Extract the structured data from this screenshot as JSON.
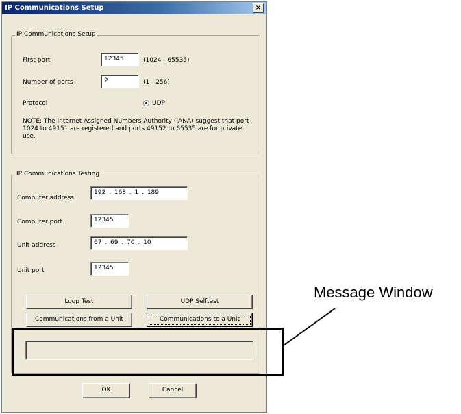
{
  "dialog": {
    "title": "IP Communications Setup",
    "close_glyph": "×"
  },
  "setup": {
    "group_title": "IP Communications Setup",
    "first_port": {
      "label": "First port",
      "value": "12345",
      "range": "(1024 - 65535)"
    },
    "num_ports": {
      "label": "Number of ports",
      "value": "2",
      "range": "(1 - 256)"
    },
    "protocol": {
      "label": "Protocol",
      "option": "UDP",
      "selected": true
    },
    "note": "NOTE: The Internet Assigned Numbers Authority (IANA) suggest that port 1024 to 49151 are registered and ports 49152  to 65535 are for private use."
  },
  "testing": {
    "group_title": "IP Communications Testing",
    "computer_address": {
      "label": "Computer address",
      "value": "192  .  168  .  1    .  189"
    },
    "computer_port": {
      "label": "Computer port",
      "value": "12345"
    },
    "unit_address": {
      "label": "Unit address",
      "value": "67   .  69   .  70   .  10"
    },
    "unit_port": {
      "label": "Unit port",
      "value": "12345"
    },
    "buttons": {
      "loop_test": "Loop Test",
      "udp_selftest": "UDP Selftest",
      "comm_from_unit": "Communications from a Unit",
      "comm_to_unit": "Communications to a Unit"
    },
    "message_window_text": ""
  },
  "footer": {
    "ok": "OK",
    "cancel": "Cancel"
  },
  "annotation": {
    "label": "Message Window"
  },
  "colors": {
    "dialog_bg": "#ece9d8",
    "titlebar_start": "#0a246a",
    "titlebar_end": "#a6caf0"
  }
}
